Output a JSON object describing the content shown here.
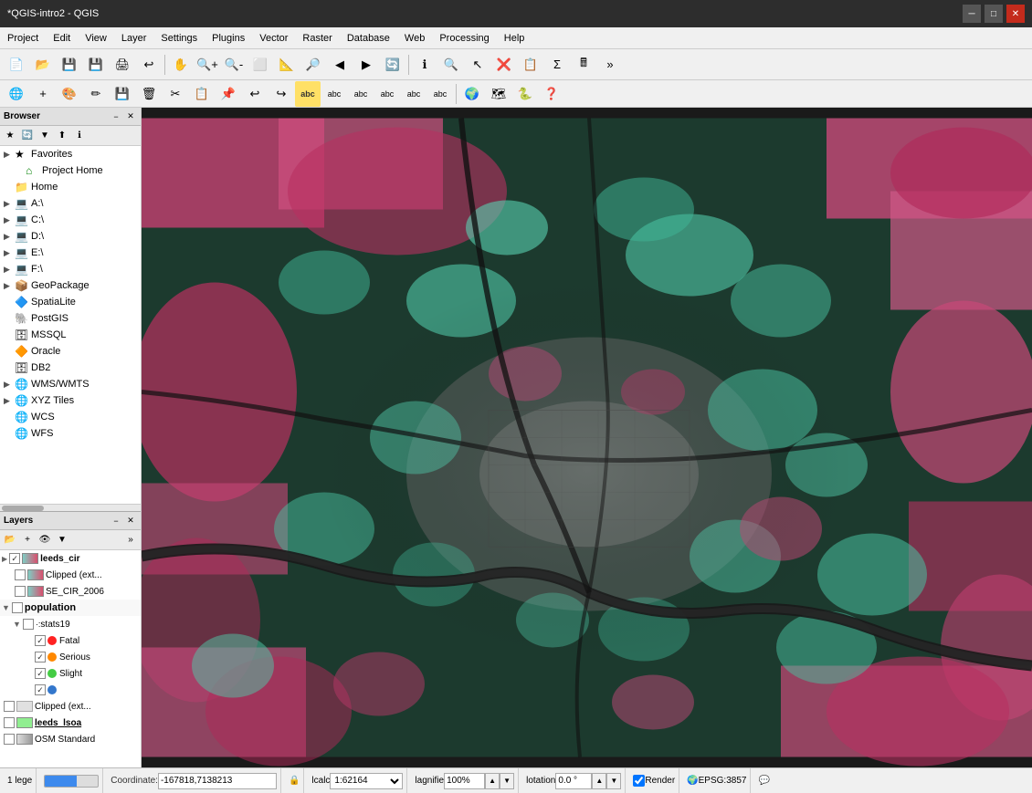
{
  "app": {
    "title": "*QGIS-intro2 - QGIS",
    "window_controls": [
      "minimize",
      "maximize",
      "close"
    ]
  },
  "menubar": {
    "items": [
      "Project",
      "Edit",
      "View",
      "Layer",
      "Settings",
      "Plugins",
      "Vector",
      "Raster",
      "Database",
      "Web",
      "Processing",
      "Help"
    ]
  },
  "browser_panel": {
    "title": "Browser",
    "items": [
      {
        "label": "Favorites",
        "icon": "★",
        "indent": 0,
        "expand": false
      },
      {
        "label": "Project Home",
        "icon": "🏠",
        "indent": 1,
        "expand": false
      },
      {
        "label": "Home",
        "icon": "📁",
        "indent": 0,
        "expand": false
      },
      {
        "label": "A:\\",
        "icon": "💻",
        "indent": 0,
        "expand": false
      },
      {
        "label": "C:\\",
        "icon": "💻",
        "indent": 0,
        "expand": false
      },
      {
        "label": "D:\\",
        "icon": "💻",
        "indent": 0,
        "expand": false
      },
      {
        "label": "E:\\",
        "icon": "💻",
        "indent": 0,
        "expand": false
      },
      {
        "label": "F:\\",
        "icon": "💻",
        "indent": 0,
        "expand": false
      },
      {
        "label": "GeoPackage",
        "icon": "📦",
        "indent": 0,
        "expand": false
      },
      {
        "label": "SpatiaLite",
        "icon": "🔷",
        "indent": 0,
        "expand": false
      },
      {
        "label": "PostGIS",
        "icon": "🐘",
        "indent": 0,
        "expand": false
      },
      {
        "label": "MSSQL",
        "icon": "🗄",
        "indent": 0,
        "expand": false
      },
      {
        "label": "Oracle",
        "icon": "🔶",
        "indent": 0,
        "expand": false
      },
      {
        "label": "DB2",
        "icon": "🗄",
        "indent": 0,
        "expand": false
      },
      {
        "label": "WMS/WMTS",
        "icon": "🌐",
        "indent": 0,
        "expand": false
      },
      {
        "label": "XYZ Tiles",
        "icon": "🌐",
        "indent": 0,
        "expand": false
      },
      {
        "label": "WCS",
        "icon": "🌐",
        "indent": 0,
        "expand": false
      },
      {
        "label": "WFS",
        "icon": "🌐",
        "indent": 0,
        "expand": false
      }
    ]
  },
  "layers_panel": {
    "title": "Layers",
    "items": [
      {
        "id": "leeds_cir",
        "label": "leeds_cir",
        "checked": true,
        "type": "raster",
        "indent": 0,
        "bold": true,
        "group": false,
        "expanded": false
      },
      {
        "id": "clipped_ext1",
        "label": "Clipped (ext...",
        "checked": false,
        "type": "raster",
        "indent": 1,
        "bold": false,
        "group": false,
        "expanded": false
      },
      {
        "id": "se_cir_2006",
        "label": "SE_CIR_2006",
        "checked": false,
        "type": "raster",
        "indent": 1,
        "bold": false,
        "group": false,
        "expanded": false
      },
      {
        "id": "population",
        "label": "population",
        "checked": false,
        "type": "group",
        "indent": 0,
        "bold": false,
        "group": true,
        "expanded": true
      },
      {
        "id": "stats19",
        "label": "stats19",
        "checked": false,
        "type": "vector",
        "indent": 1,
        "bold": false,
        "group": false,
        "expanded": true
      },
      {
        "id": "fatal",
        "label": "Fatal",
        "checked": true,
        "type": "legend",
        "color": "#ff2222",
        "indent": 2,
        "bold": false,
        "group": false
      },
      {
        "id": "serious",
        "label": "Serious",
        "checked": true,
        "type": "legend",
        "color": "#ff8800",
        "indent": 2,
        "bold": false,
        "group": false
      },
      {
        "id": "slight",
        "label": "Slight",
        "checked": true,
        "type": "legend",
        "color": "#44cc44",
        "indent": 2,
        "bold": false,
        "group": false
      },
      {
        "id": "unknown",
        "label": "",
        "checked": true,
        "type": "legend",
        "color": "#3377cc",
        "indent": 2,
        "bold": false,
        "group": false
      },
      {
        "id": "clipped_ext2",
        "label": "Clipped (ext...",
        "checked": false,
        "type": "vector",
        "indent": 0,
        "bold": false,
        "group": false
      },
      {
        "id": "leeds_lsoa",
        "label": "leeds_lsoa",
        "checked": false,
        "type": "vector",
        "indent": 0,
        "bold": true,
        "group": false
      },
      {
        "id": "osm_standard",
        "label": "OSM Standard",
        "checked": false,
        "type": "raster",
        "indent": 0,
        "bold": false,
        "group": false
      }
    ]
  },
  "statusbar": {
    "legend_count": "1 lege",
    "coordinates_label": "Coordinate:",
    "coordinates_value": "-167818,7138213",
    "lock_icon": "🔒",
    "scale_label": "lcalc",
    "scale_value": "1:62164",
    "magnifier_label": "lagnifie",
    "magnifier_value": "100%",
    "rotation_label": "lotation",
    "rotation_value": "0.0 °",
    "render_label": "Render",
    "render_checked": true,
    "epsg_label": "EPSG:3857",
    "messages_icon": "💬"
  }
}
